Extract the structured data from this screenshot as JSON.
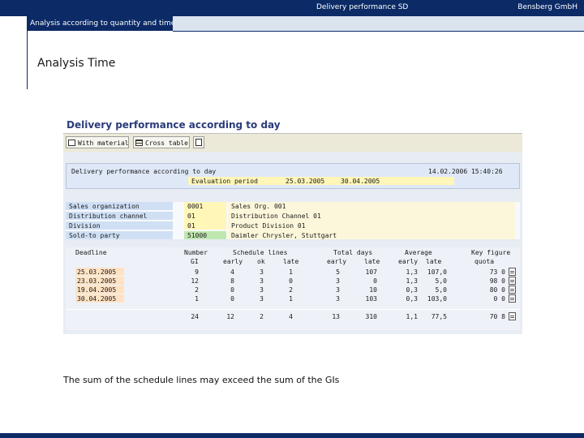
{
  "header": {
    "doc_title": "Delivery performance SD",
    "company": "Bensberg GmbH"
  },
  "tab": {
    "active": "Analysis according to quantity and time"
  },
  "section_title": "Analysis Time",
  "caption": "The sum of the schedule lines may exceed the sum of the GIs",
  "sap": {
    "title": "Delivery performance according to day",
    "toolbar": {
      "with_material": "With material",
      "cross_table": "Cross table"
    },
    "report_title": "Delivery performance according to day",
    "report_datetime": "14.02.2006 15:40:26",
    "eval_label": "Evaluation period",
    "eval_from": "25.03.2005",
    "eval_to": "30.04.2005",
    "org": [
      {
        "label": "Sales organization",
        "code": "0001",
        "text": "Sales Org. 001"
      },
      {
        "label": "Distribution channel",
        "code": "01",
        "text": "Distribution Channel 01"
      },
      {
        "label": "Division",
        "code": "01",
        "text": "Product Division 01"
      },
      {
        "label": "Sold-to party",
        "code": "51000",
        "text": "Daimler Chrysler, Stuttgart"
      }
    ],
    "headers1": {
      "deadline": "Deadline",
      "number": "Number",
      "sched": "Schedule lines",
      "days": "Total days",
      "avg": "Average",
      "key": "Key figure"
    },
    "headers2": {
      "number": "GI",
      "sched_early": "early",
      "sched_ok": "ok",
      "sched_late": "late",
      "days_early": "early",
      "days_late": "late",
      "avg_early": "early",
      "avg_late": "late",
      "key": "quota"
    },
    "rows": [
      {
        "date": "25.03.2005",
        "gi": "9",
        "early": "4",
        "ok": "3",
        "late": "1",
        "days_early": "5",
        "days_late": "107",
        "avg_early": "1,3",
        "avg_late": "107,0",
        "key": "73 0"
      },
      {
        "date": "23.03.2005",
        "gi": "12",
        "early": "8",
        "ok": "3",
        "late": "0",
        "days_early": "3",
        "days_late": "0",
        "avg_early": "1,3",
        "avg_late": "5,0",
        "key": "98 0"
      },
      {
        "date": "19.04.2005",
        "gi": "2",
        "early": "0",
        "ok": "3",
        "late": "2",
        "days_early": "3",
        "days_late": "10",
        "avg_early": "0,3",
        "avg_late": "5,0",
        "key": "80 0"
      },
      {
        "date": "30.04.2005",
        "gi": "1",
        "early": "0",
        "ok": "3",
        "late": "1",
        "days_early": "3",
        "days_late": "103",
        "avg_early": "0,3",
        "avg_late": "103,0",
        "key": "0 0"
      }
    ],
    "totals": {
      "gi": "24",
      "early": "12",
      "ok": "2",
      "late": "4",
      "days_early": "13",
      "days_late": "310",
      "avg_early": "1,1",
      "avg_late": "77,5",
      "key": "70 8"
    }
  }
}
